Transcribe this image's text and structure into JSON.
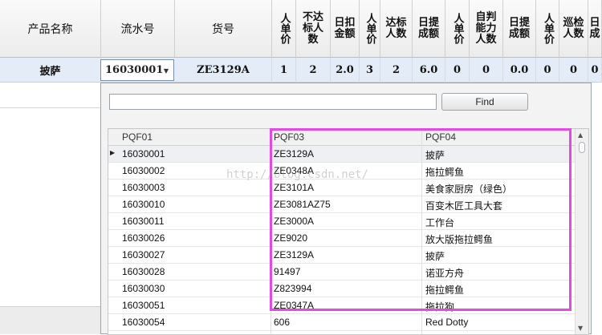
{
  "grid": {
    "headers": {
      "product_name": "产品名称",
      "serial_no": "流水号",
      "item_no": "货号",
      "unit_price_1": "人单价",
      "unqualified_count": "不达标人数",
      "deduct_amount": "日扣金额",
      "unit_price_2": "人单价",
      "qualified_count": "达标人数",
      "commission": "日提成额",
      "unit_price_3": "人单价",
      "self_judge_count": "自判能力人数",
      "commission_2": "日提成额",
      "unit_price_4": "人单价",
      "patrol_count": "巡检人数",
      "truncated": "日成"
    },
    "row": {
      "product_name": "披萨",
      "serial_no": "16030001",
      "item_no": "ZE3129A",
      "unit_price_1": "1",
      "unqualified_count": "2",
      "deduct_amount": "2.0",
      "unit_price_2": "3",
      "qualified_count": "2",
      "commission": "6.0",
      "unit_price_3": "0",
      "self_judge_count": "0",
      "commission_2": "0.0",
      "unit_price_4": "0",
      "patrol_count": "0",
      "truncated": "0"
    }
  },
  "popup": {
    "search_value": "",
    "find_label": "Find",
    "columns": [
      "PQF01",
      "PQF03",
      "PQF04"
    ],
    "rows": [
      [
        "16030001",
        "ZE3129A",
        "披萨"
      ],
      [
        "16030002",
        "ZE0348A",
        "拖拉鳄鱼"
      ],
      [
        "16030003",
        "ZE3101A",
        "美食家厨房（绿色）"
      ],
      [
        "16030010",
        "ZE3081AZ75",
        "百变木匠工具大套"
      ],
      [
        "16030011",
        "ZE3000A",
        "工作台"
      ],
      [
        "16030026",
        "ZE9020",
        "放大版拖拉鳄鱼"
      ],
      [
        "16030027",
        "ZE3129A",
        "披萨"
      ],
      [
        "16030028",
        "91497",
        "诺亚方舟"
      ],
      [
        "16030030",
        "Z823994",
        "拖拉鳄鱼"
      ],
      [
        "16030051",
        "ZE0347A",
        "拖拉狗"
      ],
      [
        "16030054",
        "606",
        "Red Dotty"
      ]
    ],
    "selected_index": 0
  },
  "watermark": "http://blog.csdn.net/",
  "colors": {
    "highlight": "#e04ce0",
    "selected_row": "#e4ecf7"
  },
  "icons": {
    "combo_arrow": "dropdown-arrow-icon",
    "row_indicator": "row-indicator-icon",
    "scroll_up": "scroll-up-icon",
    "scroll_down": "scroll-down-icon"
  }
}
